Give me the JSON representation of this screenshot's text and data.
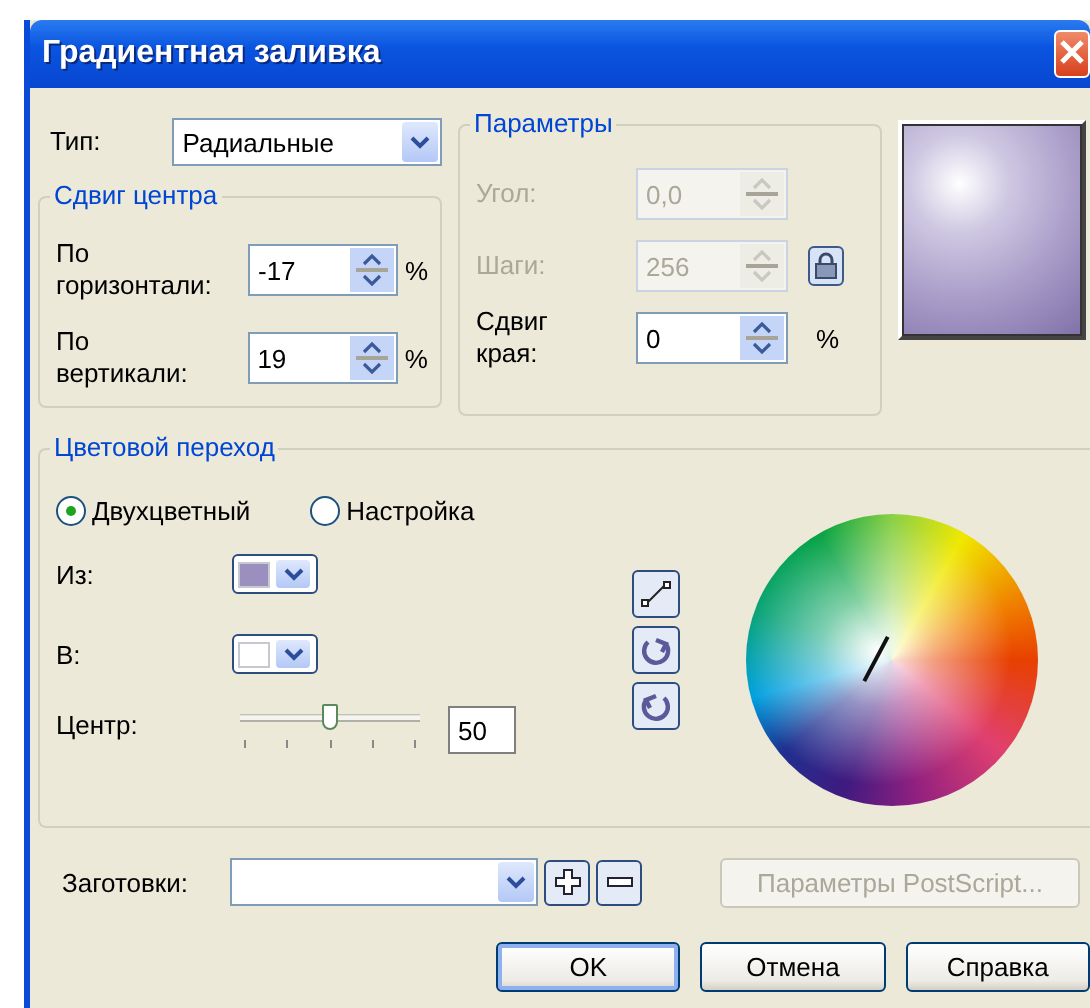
{
  "window": {
    "title": "Градиентная заливка"
  },
  "type": {
    "label": "Тип:",
    "value": "Радиальные"
  },
  "center_offset": {
    "title": "Сдвиг центра",
    "fields": [
      {
        "label": "По горизонтали:",
        "value": "-17",
        "unit": "%"
      },
      {
        "label": "По вертикали:",
        "value": "19",
        "unit": "%"
      }
    ]
  },
  "parameters": {
    "title": "Параметры",
    "fields": [
      {
        "label": "Угол:",
        "value": "0,0",
        "disabled": true
      },
      {
        "label": "Шаги:",
        "value": "256",
        "disabled": true,
        "lock": true
      },
      {
        "label": "Сдвиг края:",
        "value": "0",
        "unit": "%"
      }
    ]
  },
  "color_blend": {
    "title": "Цветовой переход",
    "modes": [
      {
        "label": "Двухцветный",
        "selected": true
      },
      {
        "label": "Настройка",
        "selected": false
      }
    ],
    "colors": [
      {
        "label": "Из:",
        "color": "#9b8fc0"
      },
      {
        "label": "В:",
        "color": "#ffffff"
      }
    ],
    "center": {
      "label": "Центр:",
      "level": 0.5,
      "value": "50"
    },
    "directions": [
      {
        "kind": "line"
      },
      {
        "kind": "ccw"
      },
      {
        "kind": "cw"
      }
    ]
  },
  "presets": {
    "label": "Заготовки:"
  },
  "postscript_button": {
    "label": "Параметры PostScript...",
    "disabled": true
  },
  "buttons": [
    {
      "label": "OK",
      "default": true
    },
    {
      "label": "Отмена",
      "default": false
    },
    {
      "label": "Справка",
      "default": false
    }
  ]
}
